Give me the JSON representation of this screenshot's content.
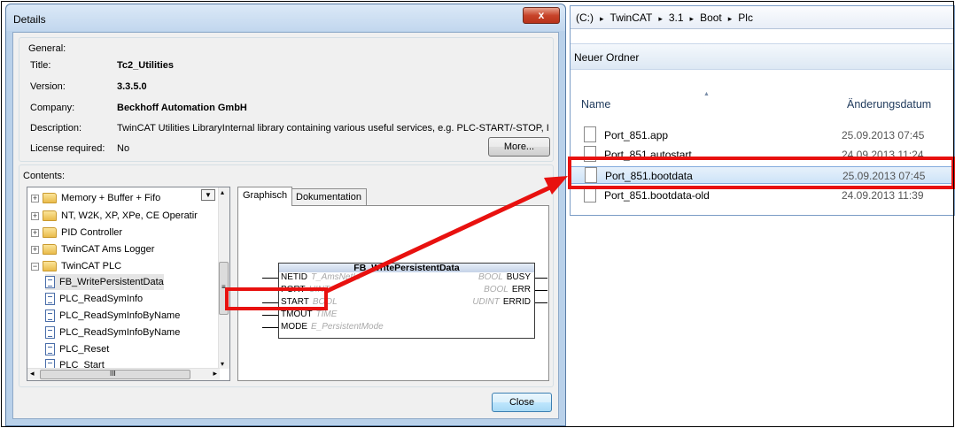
{
  "dialog": {
    "title": "Details",
    "close_glyph": "x",
    "general": {
      "heading": "General:",
      "title_label": "Title:",
      "title_value": "Tc2_Utilities",
      "version_label": "Version:",
      "version_value": "3.3.5.0",
      "company_label": "Company:",
      "company_value": "Beckhoff Automation GmbH",
      "description_label": "Description:",
      "description_value": "TwinCAT Utilities LibraryInternal library containing various useful services,  e.g. PLC-START/-STOP, I",
      "license_label": "License required:",
      "license_value": "No",
      "more_button": "More..."
    },
    "contents": {
      "heading": "Contents:",
      "tree": [
        {
          "label": "Memory + Buffer + Fifo",
          "type": "folder",
          "expander": "+"
        },
        {
          "label": "NT, W2K, XP, XPe, CE Operatir",
          "type": "folder",
          "expander": "+"
        },
        {
          "label": "PID Controller",
          "type": "folder",
          "expander": "+"
        },
        {
          "label": "TwinCAT Ams Logger",
          "type": "folder",
          "expander": "+"
        },
        {
          "label": "TwinCAT PLC",
          "type": "folder",
          "expander": "−"
        },
        {
          "label": "FB_WritePersistentData",
          "type": "doc"
        },
        {
          "label": "PLC_ReadSymInfo",
          "type": "doc"
        },
        {
          "label": "PLC_ReadSymInfoByName",
          "type": "doc"
        },
        {
          "label": "PLC_ReadSymInfoByName",
          "type": "doc"
        },
        {
          "label": "PLC_Reset",
          "type": "doc"
        },
        {
          "label": "PLC_Start",
          "type": "doc"
        }
      ],
      "scroll_left": "◂",
      "scroll_right": "▸",
      "scroll_grip": "III",
      "scroll_up": "▴",
      "scroll_down": "▾",
      "scroll_vgrip": "≡",
      "dropdown_glyph": "▼"
    },
    "tabs": {
      "graphic": "Graphisch",
      "docs": "Dokumentation"
    },
    "fb": {
      "name": "FB_WritePersistentData",
      "inputs": [
        {
          "name": "NETID",
          "type": "T_AmsNetId"
        },
        {
          "name": "PORT",
          "type": "UINT"
        },
        {
          "name": "START",
          "type": "BOOL"
        },
        {
          "name": "TMOUT",
          "type": "TIME"
        },
        {
          "name": "MODE",
          "type": "E_PersistentMode"
        }
      ],
      "outputs": [
        {
          "name": "BUSY",
          "type": "BOOL"
        },
        {
          "name": "ERR",
          "type": "BOOL"
        },
        {
          "name": "ERRID",
          "type": "UDINT"
        }
      ]
    },
    "close_button": "Close"
  },
  "explorer": {
    "breadcrumb": [
      "(C:)",
      "TwinCAT",
      "3.1",
      "Boot",
      "Plc"
    ],
    "breadcrumb_sep": "▸",
    "new_folder": "Neuer Ordner",
    "columns": {
      "name": "Name",
      "date": "Änderungsdatum"
    },
    "files": [
      {
        "name": "Port_851.app",
        "date": "25.09.2013 07:45"
      },
      {
        "name": "Port_851.autostart",
        "date": "24.09.2013 11:24"
      },
      {
        "name": "Port_851.bootdata",
        "date": "25.09.2013 07:45"
      },
      {
        "name": "Port_851.bootdata-old",
        "date": "24.09.2013 11:39"
      }
    ]
  },
  "colors": {
    "annotation": "#e8110f",
    "selection": "#cde3f8"
  }
}
